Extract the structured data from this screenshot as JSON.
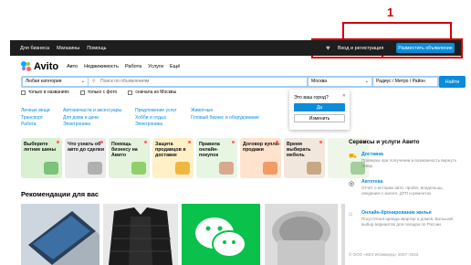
{
  "annotation": {
    "marker_number": "1"
  },
  "topbar": {
    "links": [
      "Для бизнеса",
      "Магазины",
      "Помощь"
    ],
    "login_label": "Вход и регистрация",
    "post_ad_label": "Разместить объявление"
  },
  "header": {
    "logo_text": "Avito",
    "nav": [
      "Авто",
      "Недвижимость",
      "Работа",
      "Услуги",
      "Ещё"
    ]
  },
  "search": {
    "category_value": "Любая категория",
    "placeholder": "Поиск по объявлениям",
    "city_value": "Москва",
    "radius_value": "Радиус / Метро / Район",
    "find_label": "Найти"
  },
  "filters": [
    "только в названиях",
    "только с фото",
    "сначала из Москвы"
  ],
  "city_popup": {
    "question": "Это ваш город?",
    "yes_label": "Да",
    "change_label": "Изменить"
  },
  "quick_links": [
    [
      "Личные вещи",
      "Транспорт",
      "Работа"
    ],
    [
      "Автозапчасти и аксессуары",
      "Для дома и дачи",
      "Электроника"
    ],
    [
      "Предложение услуг",
      "Хобби и отдых",
      "Электроника"
    ],
    [
      "Животные",
      "Готовый бизнес и оборудование"
    ]
  ],
  "tiles": [
    {
      "title": "Выберите летние шины",
      "bg": "#d9f0d1",
      "pic": "#7bc27a"
    },
    {
      "title": "Что узнать об авто до сделки",
      "bg": "#eaeaea",
      "pic": "#b0b0b0"
    },
    {
      "title": "Помощь бизнесу на Авито",
      "bg": "#e4f3dc",
      "pic": "#8fd06a"
    },
    {
      "title": "Защита продавцов в доставке",
      "bg": "#fff0c8",
      "pic": "#f0b740"
    },
    {
      "title": "Правила онлайн-покупок",
      "bg": "#e7f6e3",
      "pic": "#d8a98e"
    },
    {
      "title": "Договор купли-продажи",
      "bg": "#ffe3cf",
      "pic": "#f29b63"
    },
    {
      "title": "Время выбирать мебель",
      "bg": "#f1e7dd",
      "pic": "#c8a882"
    },
    {
      "title": "",
      "bg": "#eef6ea",
      "pic": "#a2cf9a"
    }
  ],
  "sidebar": {
    "heading": "Сервисы и услуги Авито",
    "services": [
      {
        "icon": "truck-icon",
        "title": "Доставка",
        "desc": "Проверка при получении и возможность вернуть товар"
      },
      {
        "icon": "car-check-icon",
        "title": "Автотека",
        "desc": "Отчёт о истории авто: пробег, владельцы, сведения о залоге, ДТП и ремонтах"
      },
      {
        "icon": "house-icon",
        "title": "Онлайн-бронирование жилья",
        "desc": "Посуточная аренда квартир и домов. Большой выбор вариантов для поездок по России"
      }
    ],
    "copyright": "© ООО «КЕХ еКоммерц» 2007–2022"
  },
  "recommendations": {
    "title": "Рекомендации для вас"
  },
  "colors": {
    "brand_blue": "#0a8cd9",
    "topbar_bg": "#1e1e1e",
    "search_frame": "#a5cdef",
    "annotation_red": "#d00000"
  }
}
